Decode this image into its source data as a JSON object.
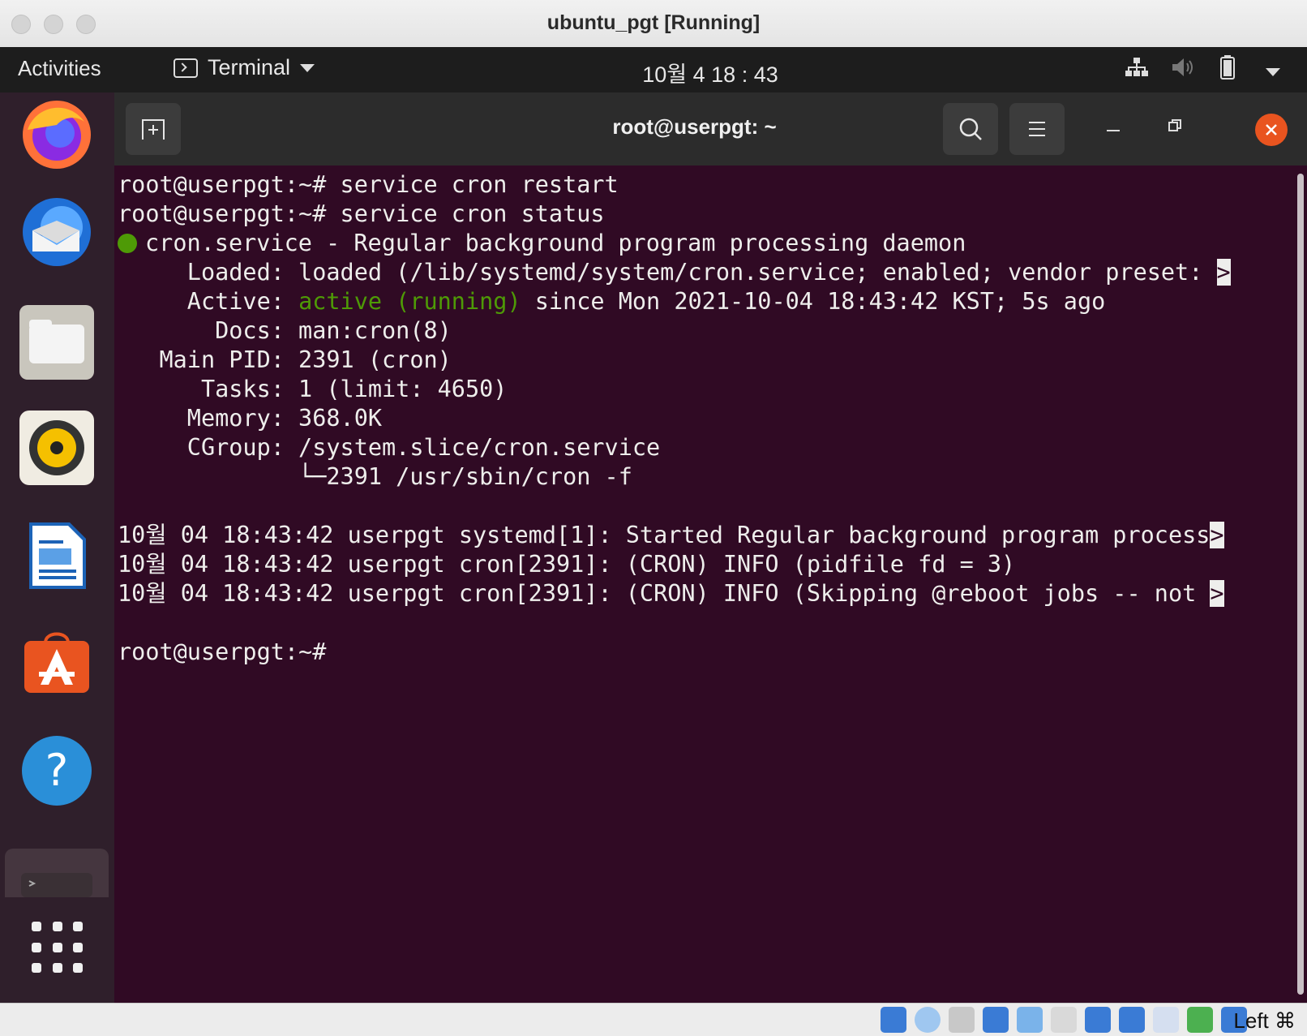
{
  "window": {
    "title": "ubuntu_pgt [Running]"
  },
  "topbar": {
    "activities": "Activities",
    "app_menu": "Terminal",
    "clock": "10월 4 18 : 43",
    "tray_icons": [
      "network-icon",
      "volume-muted-icon",
      "battery-icon",
      "system-menu-chevron-icon"
    ]
  },
  "dock": {
    "apps": [
      "Firefox",
      "Thunderbird",
      "Files",
      "Rhythmbox",
      "LibreOffice Writer",
      "Ubuntu Software",
      "Help",
      "Terminal"
    ],
    "show_apps": "Show Applications"
  },
  "terminal": {
    "title": "root@userpgt: ~",
    "lines": [
      "root@userpgt:~# service cron restart",
      "root@userpgt:~# service cron status",
      "cron.service - Regular background program processing daemon",
      "     Loaded: loaded (/lib/systemd/system/cron.service; enabled; vendor preset: ",
      "     Active: ",
      "active (running)",
      " since Mon 2021-10-04 18:43:42 KST; 5s ago",
      "       Docs: man:cron(8)",
      "   Main PID: 2391 (cron)",
      "      Tasks: 1 (limit: 4650)",
      "     Memory: 368.0K",
      "     CGroup: /system.slice/cron.service",
      "             └─2391 /usr/sbin/cron -f",
      "",
      "10월 04 18:43:42 userpgt systemd[1]: Started Regular background program process",
      "10월 04 18:43:42 userpgt cron[2391]: (CRON) INFO (pidfile fd = 3)",
      "10월 04 18:43:42 userpgt cron[2391]: (CRON) INFO (Skipping @reboot jobs -- not ",
      "",
      "root@userpgt:~# "
    ],
    "truncation_marker": ">"
  },
  "statusbar": {
    "host_key": "Left ⌘"
  },
  "colors": {
    "terminal_bg": "#300a24",
    "status_green": "#4e9a06",
    "close_orange": "#e9541f"
  }
}
